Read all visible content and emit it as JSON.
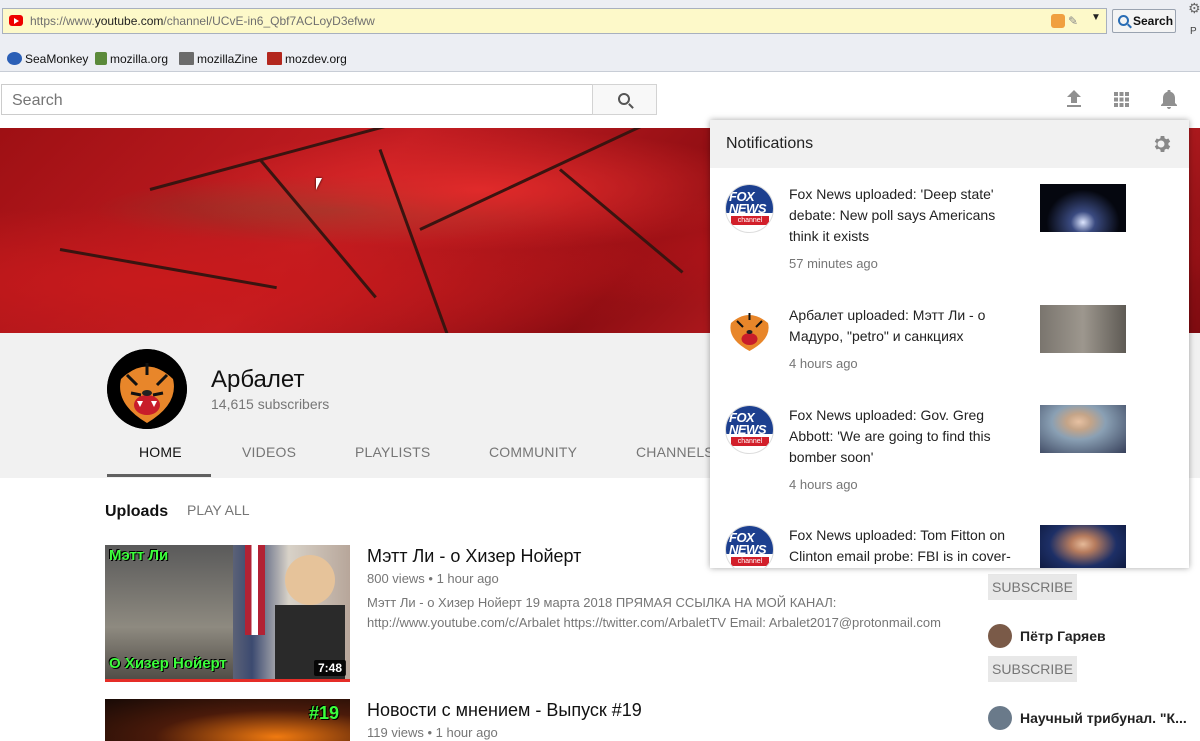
{
  "browser": {
    "url_prefix": "https://www.",
    "url_domain": "youtube.com",
    "url_path": "/channel/UCvE-in6_Qbf7ACLoyD3efww",
    "search_label": "Search",
    "side_label": "P",
    "bookmarks": [
      {
        "label": "SeaMonkey",
        "icon": "seamonkey-icon"
      },
      {
        "label": "mozilla.org",
        "icon": "mozilla-icon"
      },
      {
        "label": "mozillaZine",
        "icon": "mozillazine-icon"
      },
      {
        "label": "mozdev.org",
        "icon": "mozdev-icon"
      }
    ]
  },
  "masthead": {
    "search_placeholder": "Search"
  },
  "channel": {
    "name": "Арбалет",
    "subscribers": "14,615 subscribers",
    "tabs": [
      "HOME",
      "VIDEOS",
      "PLAYLISTS",
      "COMMUNITY",
      "CHANNELS"
    ],
    "active_tab": "HOME"
  },
  "uploads": {
    "title": "Uploads",
    "play_all": "PLAY ALL",
    "videos": [
      {
        "title": "Мэтт Ли - о Хизер Нойерт",
        "views": "800 views",
        "age": "1 hour ago",
        "duration": "7:48",
        "thumb_top": "Мэтт Ли",
        "thumb_bottom": "О Хизер Нойерт",
        "description_line1": "Мэтт Ли - о Хизер Нойерт 19 марта 2018 ПРЯМАЯ ССЫЛКА НА МОЙ КАНАЛ:",
        "description_line2": "http://www.youtube.com/c/Arbalet https://twitter.com/ArbaletTV Email: Arbalet2017@protonmail.com"
      },
      {
        "title": "Новости с мнением - Выпуск #19",
        "views": "119 views",
        "age": "1 hour ago",
        "thumb_badge": "#19"
      }
    ]
  },
  "related_channels": {
    "subscribe_label": "SUBSCRIBE",
    "items": [
      {
        "name": "Пётр Гаряев"
      },
      {
        "name": "Научный трибунал. \"К..."
      }
    ]
  },
  "notifications": {
    "title": "Notifications",
    "items": [
      {
        "text": "Fox News uploaded: 'Deep state' debate: New poll says Americans think it exists",
        "time": "57 minutes ago",
        "source": "fox"
      },
      {
        "text": "Арбалет uploaded: Мэтт Ли - о Мадуро, \"petro\" и санкциях",
        "time": "4 hours ago",
        "source": "tiger"
      },
      {
        "text": "Fox News uploaded: Gov. Greg Abbott: 'We are going to find this bomber soon'",
        "time": "4 hours ago",
        "source": "fox"
      },
      {
        "text": "Fox News uploaded: Tom Fitton on Clinton email probe: FBI is in cover-up",
        "time": "",
        "source": "fox"
      }
    ],
    "fox_logo_text": "FOX NEWS",
    "fox_logo_sub": "channel"
  }
}
